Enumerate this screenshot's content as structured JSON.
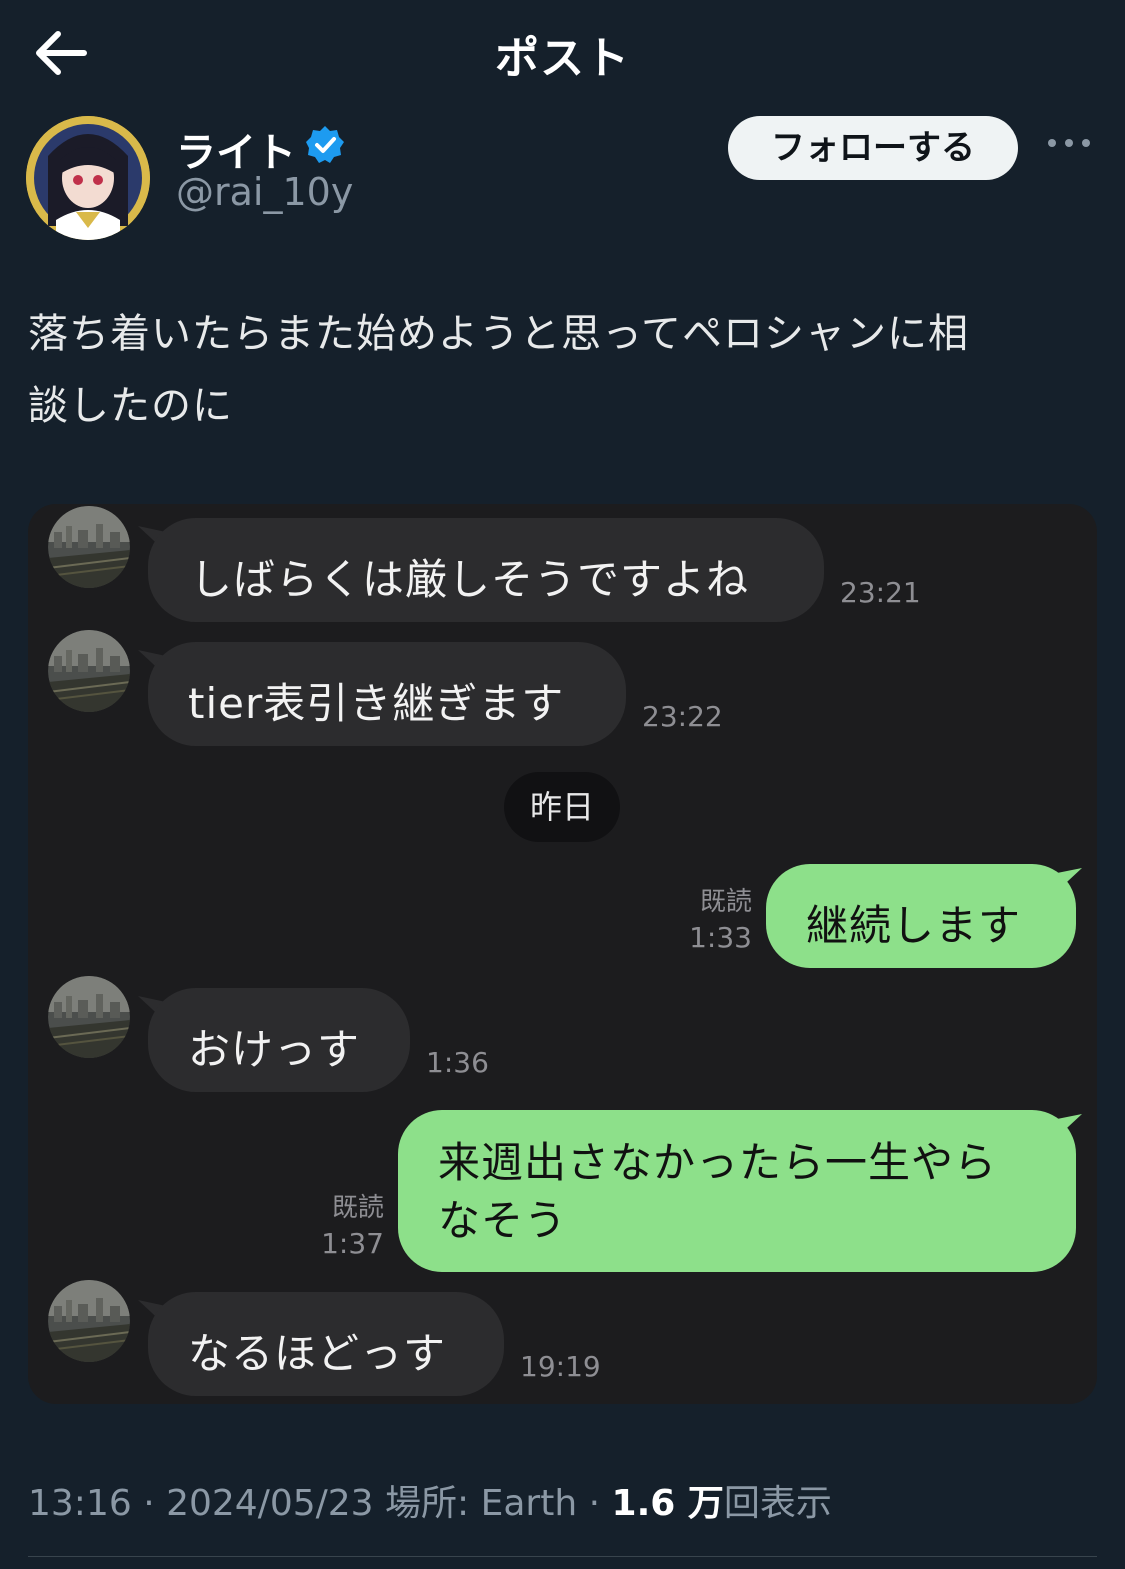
{
  "header": {
    "title": "ポスト"
  },
  "author": {
    "display_name": "ライト",
    "handle": "@rai_10y",
    "follow_label": "フォローする"
  },
  "tweet": {
    "text_line1": "落ち着いたらまた始めようと思ってペロシャンに相",
    "text_line2": "談したのに"
  },
  "chat": {
    "messages": [
      {
        "direction": "in",
        "text": "しばらくは厳しそうですよね",
        "time": "23:21"
      },
      {
        "direction": "in",
        "text": "tier表引き継ぎます",
        "time": "23:22"
      },
      {
        "direction": "date",
        "text": "昨日"
      },
      {
        "direction": "out",
        "text": "継続します",
        "read": "既読",
        "time": "1:33"
      },
      {
        "direction": "in",
        "text": "おけっす",
        "time": "1:36"
      },
      {
        "direction": "out",
        "text_line1": "来週出さなかったら一生やら",
        "text_line2": "なそう",
        "read": "既読",
        "time": "1:37"
      },
      {
        "direction": "in",
        "text": "なるほどっす",
        "time": "19:19"
      }
    ]
  },
  "meta": {
    "time": "13:16",
    "sep1": " · ",
    "date": "2024/05/23",
    "location_label": " 場所: ",
    "location": "Earth",
    "sep2": " · ",
    "views_count": "1.6 万",
    "views_label": "回表示"
  },
  "colors": {
    "background": "#15202b",
    "chat_bg": "#1c1c1e",
    "incoming_bubble": "#2c2c2e",
    "outgoing_bubble": "#8de08a",
    "verified": "#1d9bf0"
  },
  "icons": {
    "back": "arrow-left-icon",
    "verified": "verified-badge-icon",
    "more": "more-horizontal-icon"
  }
}
